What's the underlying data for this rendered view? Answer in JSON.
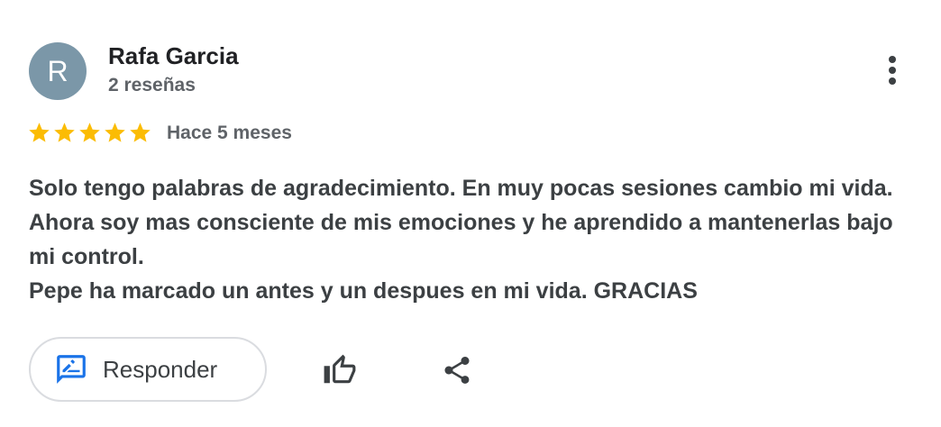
{
  "review": {
    "author": {
      "initial": "R",
      "name": "Rafa Garcia",
      "review_count": "2 reseñas",
      "avatar_color": "#7b97a8"
    },
    "rating": 5,
    "max_rating": 5,
    "star_color": "#fbbc04",
    "date": "Hace 5 meses",
    "text": "Solo tengo palabras de agradecimiento. En muy pocas sesiones cambio mi vida. Ahora soy mas consciente de mis emociones y he aprendido a mantenerlas bajo mi control.\nPepe ha marcado un antes y un despues en mi vida. GRACIAS"
  },
  "actions": {
    "reply_label": "Responder",
    "reply_icon": "rate-review-icon",
    "reply_icon_color": "#1a73e8",
    "like_icon": "thumb-up-icon",
    "share_icon": "share-icon",
    "more_icon": "more-vert-icon"
  }
}
